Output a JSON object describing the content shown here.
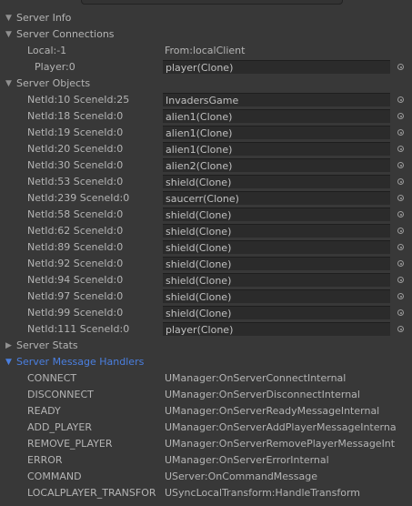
{
  "sections": {
    "info": "Server Info",
    "connections": "Server Connections",
    "objects": "Server Objects",
    "stats": "Server Stats",
    "handlers": "Server Message Handlers"
  },
  "connection": {
    "local": "Local:-1",
    "from": "From:localClient",
    "player_label": "Player:0",
    "player_value": "player(Clone)"
  },
  "objects": [
    {
      "id": "NetId:10 SceneId:25",
      "name": "InvadersGame"
    },
    {
      "id": "NetId:18 SceneId:0",
      "name": "alien1(Clone)"
    },
    {
      "id": "NetId:19 SceneId:0",
      "name": "alien1(Clone)"
    },
    {
      "id": "NetId:20 SceneId:0",
      "name": "alien1(Clone)"
    },
    {
      "id": "NetId:30 SceneId:0",
      "name": "alien2(Clone)"
    },
    {
      "id": "NetId:53 SceneId:0",
      "name": "shield(Clone)"
    },
    {
      "id": "NetId:239 SceneId:0",
      "name": "saucerr(Clone)"
    },
    {
      "id": "NetId:58 SceneId:0",
      "name": "shield(Clone)"
    },
    {
      "id": "NetId:62 SceneId:0",
      "name": "shield(Clone)"
    },
    {
      "id": "NetId:89 SceneId:0",
      "name": "shield(Clone)"
    },
    {
      "id": "NetId:92 SceneId:0",
      "name": "shield(Clone)"
    },
    {
      "id": "NetId:94 SceneId:0",
      "name": "shield(Clone)"
    },
    {
      "id": "NetId:97 SceneId:0",
      "name": "shield(Clone)"
    },
    {
      "id": "NetId:99 SceneId:0",
      "name": "shield(Clone)"
    },
    {
      "id": "NetId:111 SceneId:0",
      "name": "player(Clone)"
    }
  ],
  "handlers": [
    {
      "msg": "CONNECT",
      "handler": "UManager:OnServerConnectInternal"
    },
    {
      "msg": "DISCONNECT",
      "handler": "UManager:OnServerDisconnectInternal"
    },
    {
      "msg": "READY",
      "handler": "UManager:OnServerReadyMessageInternal"
    },
    {
      "msg": "ADD_PLAYER",
      "handler": "UManager:OnServerAddPlayerMessageInterna"
    },
    {
      "msg": "REMOVE_PLAYER",
      "handler": "UManager:OnServerRemovePlayerMessageInt"
    },
    {
      "msg": "ERROR",
      "handler": "UManager:OnServerErrorInternal"
    },
    {
      "msg": "COMMAND",
      "handler": "UServer:OnCommandMessage"
    },
    {
      "msg": "LOCALPLAYER_TRANSFOR",
      "handler": "USyncLocalTransform:HandleTransform"
    }
  ],
  "colors": {
    "background": "#383838",
    "field": "#2b2b2b",
    "accent": "#4a7fe0"
  }
}
